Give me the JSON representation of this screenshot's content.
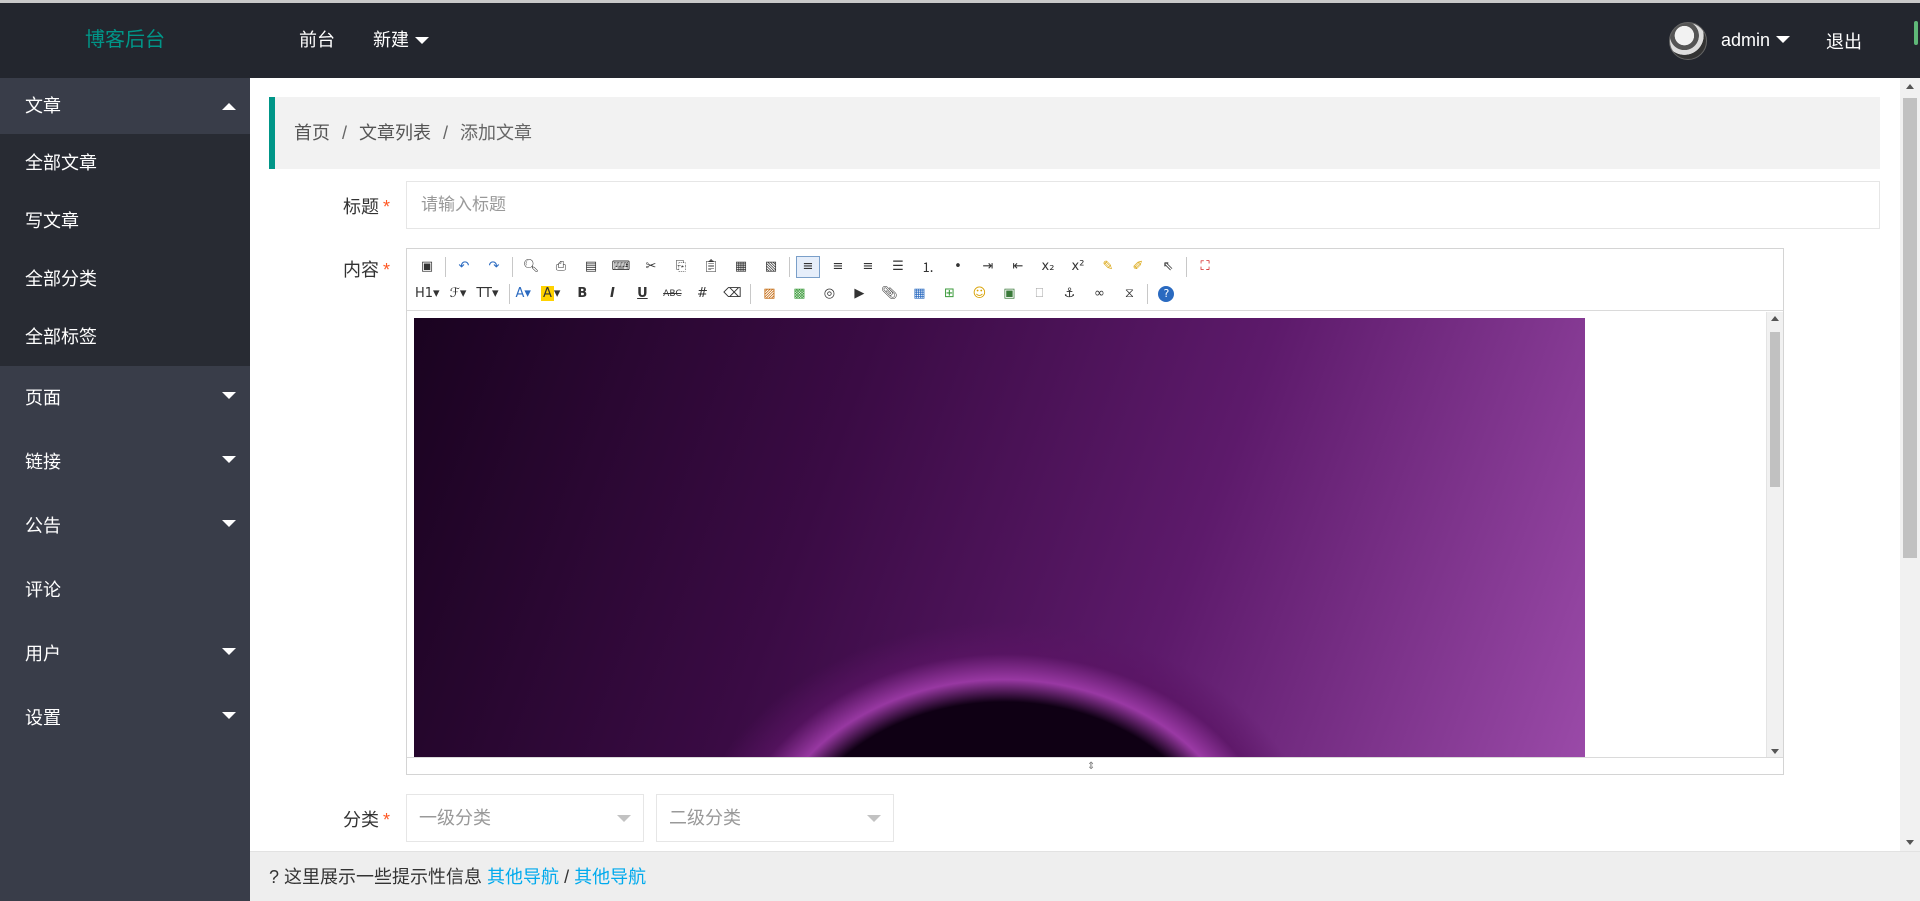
{
  "header": {
    "logo": "博客后台",
    "nav": [
      {
        "label": "前台"
      },
      {
        "label": "新建"
      }
    ],
    "user": {
      "name": "admin"
    },
    "logout": "退出"
  },
  "sidebar": {
    "groups": [
      {
        "label": "文章",
        "open": true,
        "children": [
          "全部文章",
          "写文章",
          "全部分类",
          "全部标签"
        ]
      },
      {
        "label": "页面"
      },
      {
        "label": "链接"
      },
      {
        "label": "公告"
      },
      {
        "label": "评论"
      },
      {
        "label": "用户"
      },
      {
        "label": "设置"
      }
    ]
  },
  "breadcrumb": {
    "home": "首页",
    "list": "文章列表",
    "current": "添加文章",
    "separator": "/"
  },
  "form": {
    "title": {
      "label": "标题",
      "placeholder": "请输入标题",
      "value": ""
    },
    "content": {
      "label": "内容"
    },
    "category": {
      "label": "分类",
      "level1": "一级分类",
      "level2": "二级分类"
    },
    "required_mark": "*"
  },
  "editor": {
    "toolbar": {
      "heading": "H1",
      "font_family": "ℱ",
      "font_size": "TT"
    }
  },
  "footer": {
    "icon": "?",
    "text": "这里展示一些提示性信息",
    "link1": "其他导航",
    "divider": "/",
    "link2": "其他导航"
  },
  "colors": {
    "accent": "#009688",
    "header_bg": "#23262e",
    "sidebar_bg": "#393d49",
    "sidebar_sub_bg": "#282b33",
    "required": "#FF5722"
  }
}
